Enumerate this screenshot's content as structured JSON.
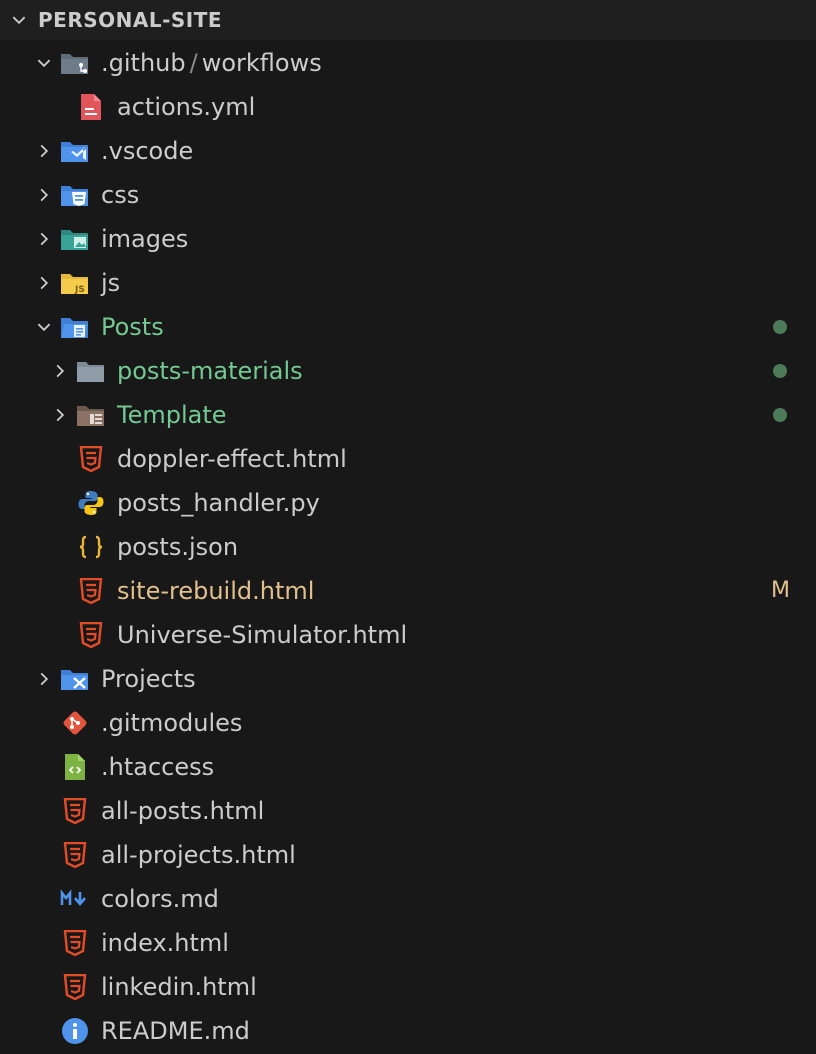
{
  "explorer": {
    "root": "PERSONAL-SITE"
  },
  "tree": {
    "github": {
      "folder": ".github",
      "sep": "/",
      "sub": "workflows"
    },
    "actions_yml": "actions.yml",
    "vscode": ".vscode",
    "css": "css",
    "images": "images",
    "js": "js",
    "posts": "Posts",
    "posts_materials": "posts-materials",
    "template": "Template",
    "doppler": "doppler-effect.html",
    "posts_handler": "posts_handler.py",
    "posts_json": "posts.json",
    "site_rebuild": "site-rebuild.html",
    "site_rebuild_badge": "M",
    "universe": "Universe-Simulator.html",
    "projects": "Projects",
    "gitmodules": ".gitmodules",
    "htaccess": ".htaccess",
    "all_posts": "all-posts.html",
    "all_projects": "all-projects.html",
    "colors_md": "colors.md",
    "index_html": "index.html",
    "linkedin_html": "linkedin.html",
    "readme": "README.md"
  },
  "colors": {
    "background": "#181818",
    "text": "#cccccc",
    "untracked_green": "#73c991",
    "modified_yellow": "#e2c08d",
    "html_orange": "#e34c26"
  }
}
